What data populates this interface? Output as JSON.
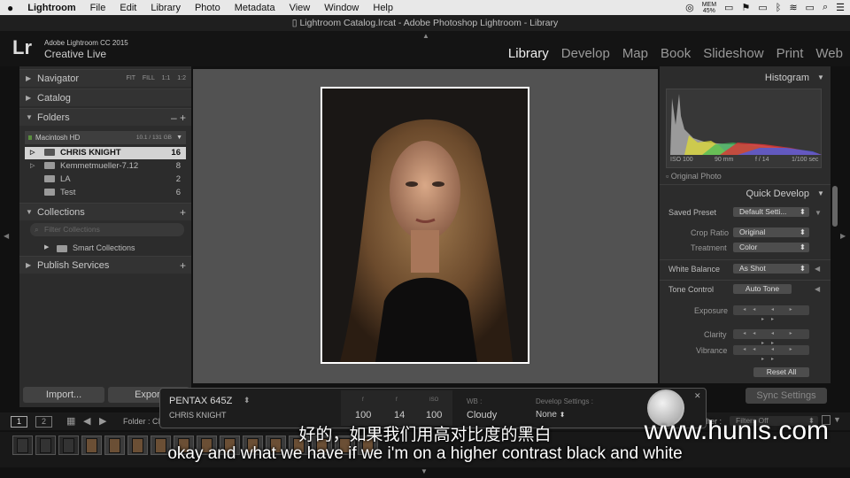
{
  "menubar": {
    "apple": "",
    "app": "Lightroom",
    "items": [
      "File",
      "Edit",
      "Library",
      "Photo",
      "Metadata",
      "View",
      "Window",
      "Help"
    ],
    "mem_label": "MEM",
    "mem_value": "45%",
    "wifi": "wifi-icon",
    "battery": "battery-icon"
  },
  "window": {
    "title": "Lightroom Catalog.lrcat - Adobe Photoshop Lightroom - Library"
  },
  "identity": {
    "logo": "Lr",
    "line1": "Adobe Lightroom CC 2015",
    "line2": "Creative Live"
  },
  "modules": [
    "Library",
    "Develop",
    "Map",
    "Book",
    "Slideshow",
    "Print",
    "Web"
  ],
  "left": {
    "navigator": "Navigator",
    "nav_modes": "FIT FILL 1:1 1:2",
    "catalog": "Catalog",
    "folders": "Folders",
    "folders_actions": "– +",
    "volume": "Macintosh HD",
    "volume_size": "10.1 / 131 GB",
    "folder_items": [
      {
        "name": "CHRIS KNIGHT",
        "count": "16"
      },
      {
        "name": "Kemmetmueller-7.12",
        "count": "8"
      },
      {
        "name": "LA",
        "count": "2"
      },
      {
        "name": "Test",
        "count": "6"
      }
    ],
    "collections": "Collections",
    "collections_add": "+",
    "filter_placeholder": "Filter Collections",
    "smart_collections": "Smart Collections",
    "publish": "Publish Services",
    "publish_add": "+",
    "import_label": "Import...",
    "export_label": "Export"
  },
  "right": {
    "histogram": "Histogram",
    "histo_info": {
      "iso": "ISO 100",
      "focal": "90 mm",
      "aperture": "f / 14",
      "shutter": "1/100 sec"
    },
    "original_photo": "Original Photo",
    "quick_develop": "Quick Develop",
    "saved_preset_label": "Saved Preset",
    "saved_preset_value": "Default Setti...",
    "crop_label": "Crop Ratio",
    "crop_value": "Original",
    "treatment_label": "Treatment",
    "treatment_value": "Color",
    "wb_label": "White Balance",
    "wb_value": "As Shot",
    "tone_label": "Tone Control",
    "auto_tone": "Auto Tone",
    "exposure": "Exposure",
    "clarity": "Clarity",
    "vibrance": "Vibrance",
    "reset_all": "Reset All",
    "sync_settings": "Sync Settings",
    "stepper": "◂◂ ◂ ▸ ▸▸"
  },
  "info_overlay": {
    "camera": "PENTAX 645Z",
    "author": "CHRIS KNIGHT",
    "col_heads": [
      "f",
      "f",
      "ISO",
      "WB :",
      "Develop Settings :"
    ],
    "values": [
      "100",
      "14",
      "100",
      "Cloudy",
      "None"
    ]
  },
  "filmstrip": {
    "page1": "1",
    "page2": "2",
    "folder_label": "Folder : CI",
    "filter_label": "Filter :",
    "filter_value": "Filters Off"
  },
  "subtitles": {
    "cn": "好的，如果我们用高对比度的黑白",
    "en": "okay and what we have if we i'm on a higher contrast black and white"
  },
  "watermark": "www.hunls.com"
}
